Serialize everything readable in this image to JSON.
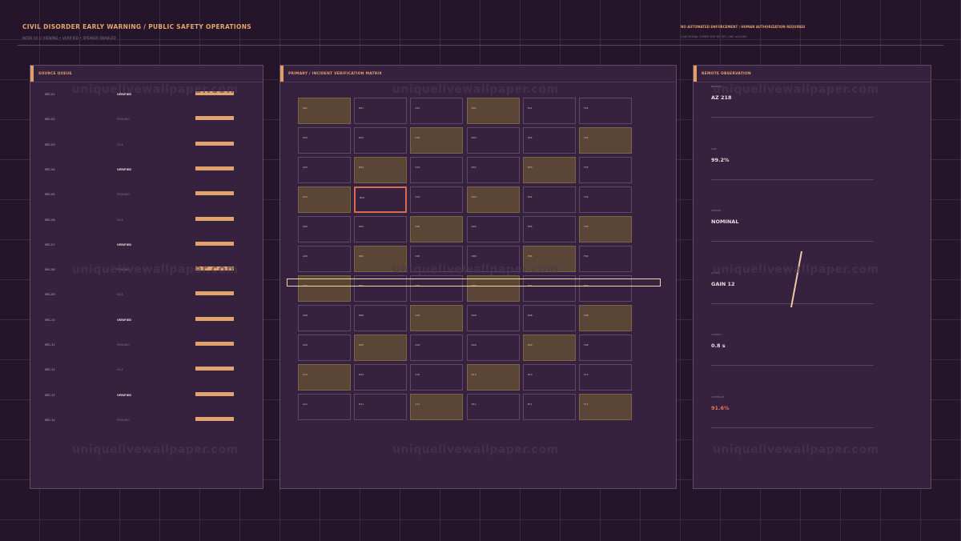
{
  "header": {
    "title": "CIVIL DISORDER EARLY WARNING / PUBLIC SAFETY OPERATIONS",
    "subtitle": "NODE 04 // VIEWING • VERIFIED • SPEAKER ENABLED",
    "notice": "NO AUTOMATED ENFORCEMENT / HUMAN AUTHORIZATION REQUIRED",
    "notice_sub": "LOW SIGNAL ZONES MAY BE OFF-LINE LOGGED"
  },
  "left_panel": {
    "title": "SOURCE QUEUE",
    "items": [
      {
        "id": "SRC-01",
        "status": "VERIFIED",
        "strong": true
      },
      {
        "id": "SRC-02",
        "status": "PENDING",
        "strong": false
      },
      {
        "id": "SRC-03",
        "status": "IDLE",
        "strong": false
      },
      {
        "id": "SRC-04",
        "status": "VERIFIED",
        "strong": true
      },
      {
        "id": "SRC-05",
        "status": "PENDING",
        "strong": false
      },
      {
        "id": "SRC-06",
        "status": "IDLE",
        "strong": false
      },
      {
        "id": "SRC-07",
        "status": "VERIFIED",
        "strong": true
      },
      {
        "id": "SRC-08",
        "status": "PENDING",
        "strong": false
      },
      {
        "id": "SRC-09",
        "status": "IDLE",
        "strong": false
      },
      {
        "id": "SRC-10",
        "status": "VERIFIED",
        "strong": true
      },
      {
        "id": "SRC-11",
        "status": "PENDING",
        "strong": false
      },
      {
        "id": "SRC-12",
        "status": "IDLE",
        "strong": false
      },
      {
        "id": "SRC-13",
        "status": "VERIFIED",
        "strong": true
      },
      {
        "id": "SRC-14",
        "status": "PENDING",
        "strong": false
      }
    ]
  },
  "center_panel": {
    "title": "PRIMARY / INCIDENT VERIFICATION MATRIX",
    "selected": "A04-B04",
    "scan_row": 7,
    "rows": [
      [
        {
          "label": "A01",
          "flag": true
        },
        {
          "label": "B01",
          "flag": false
        },
        {
          "label": "C01",
          "flag": false
        },
        {
          "label": "D01",
          "flag": true
        },
        {
          "label": "E01",
          "flag": false
        },
        {
          "label": "F01",
          "flag": false
        }
      ],
      [
        {
          "label": "A02",
          "flag": false
        },
        {
          "label": "B02",
          "flag": false
        },
        {
          "label": "C02",
          "flag": true
        },
        {
          "label": "D02",
          "flag": false
        },
        {
          "label": "E02",
          "flag": false
        },
        {
          "label": "F02",
          "flag": true
        }
      ],
      [
        {
          "label": "A03",
          "flag": false
        },
        {
          "label": "B03",
          "flag": true
        },
        {
          "label": "C03",
          "flag": false
        },
        {
          "label": "D03",
          "flag": false
        },
        {
          "label": "E03",
          "flag": true
        },
        {
          "label": "F03",
          "flag": false
        }
      ],
      [
        {
          "label": "A04",
          "flag": true
        },
        {
          "label": "B04",
          "flag": false,
          "selected": true
        },
        {
          "label": "C04",
          "flag": false
        },
        {
          "label": "D04",
          "flag": true
        },
        {
          "label": "E04",
          "flag": false
        },
        {
          "label": "F04",
          "flag": false
        }
      ],
      [
        {
          "label": "A05",
          "flag": false
        },
        {
          "label": "B05",
          "flag": false
        },
        {
          "label": "C05",
          "flag": true
        },
        {
          "label": "D05",
          "flag": false
        },
        {
          "label": "E05",
          "flag": false
        },
        {
          "label": "F05",
          "flag": true
        }
      ],
      [
        {
          "label": "A06",
          "flag": false
        },
        {
          "label": "B06",
          "flag": true
        },
        {
          "label": "C06",
          "flag": false
        },
        {
          "label": "D06",
          "flag": false
        },
        {
          "label": "E06",
          "flag": true
        },
        {
          "label": "F06",
          "flag": false
        }
      ],
      [
        {
          "label": "A07",
          "flag": true
        },
        {
          "label": "B07",
          "flag": false
        },
        {
          "label": "C07",
          "flag": false
        },
        {
          "label": "D07",
          "flag": true
        },
        {
          "label": "E07",
          "flag": false
        },
        {
          "label": "F07",
          "flag": false
        }
      ],
      [
        {
          "label": "A08",
          "flag": false
        },
        {
          "label": "B08",
          "flag": false
        },
        {
          "label": "C08",
          "flag": true
        },
        {
          "label": "D08",
          "flag": false
        },
        {
          "label": "E08",
          "flag": false
        },
        {
          "label": "F08",
          "flag": true
        }
      ],
      [
        {
          "label": "A09",
          "flag": false
        },
        {
          "label": "B09",
          "flag": true
        },
        {
          "label": "C09",
          "flag": false
        },
        {
          "label": "D09",
          "flag": false
        },
        {
          "label": "E09",
          "flag": true
        },
        {
          "label": "F09",
          "flag": false
        }
      ],
      [
        {
          "label": "A10",
          "flag": true
        },
        {
          "label": "B10",
          "flag": false
        },
        {
          "label": "C10",
          "flag": false
        },
        {
          "label": "D10",
          "flag": true
        },
        {
          "label": "E10",
          "flag": false
        },
        {
          "label": "F10",
          "flag": false
        }
      ],
      [
        {
          "label": "A11",
          "flag": false
        },
        {
          "label": "B11",
          "flag": false
        },
        {
          "label": "C11",
          "flag": true
        },
        {
          "label": "D11",
          "flag": false
        },
        {
          "label": "E11",
          "flag": false
        },
        {
          "label": "F11",
          "flag": true
        }
      ]
    ]
  },
  "right_panel": {
    "title": "REMOTE OBSERVATION",
    "metrics": [
      {
        "label": "BEARING",
        "value": "AZ 218",
        "warn": false
      },
      {
        "label": "LINK",
        "value": "99.2%",
        "warn": false
      },
      {
        "label": "SENSOR",
        "value": "NOMINAL",
        "warn": false
      },
      {
        "label": "ACTIVE",
        "value": "GAIN 12",
        "warn": false
      },
      {
        "label": "LATENCY",
        "value": "0.8 s",
        "warn": false
      },
      {
        "label": "COVERAGE",
        "value": "91.6%",
        "warn": true
      }
    ]
  },
  "watermark": "uniquelivewallpaper.com",
  "colors": {
    "accent": "#e2a068",
    "background": "#24152a",
    "panel": "#36213e",
    "flag_cell": "#5a4536",
    "selection": "#d96a4f",
    "warning": "#e07a5a"
  }
}
